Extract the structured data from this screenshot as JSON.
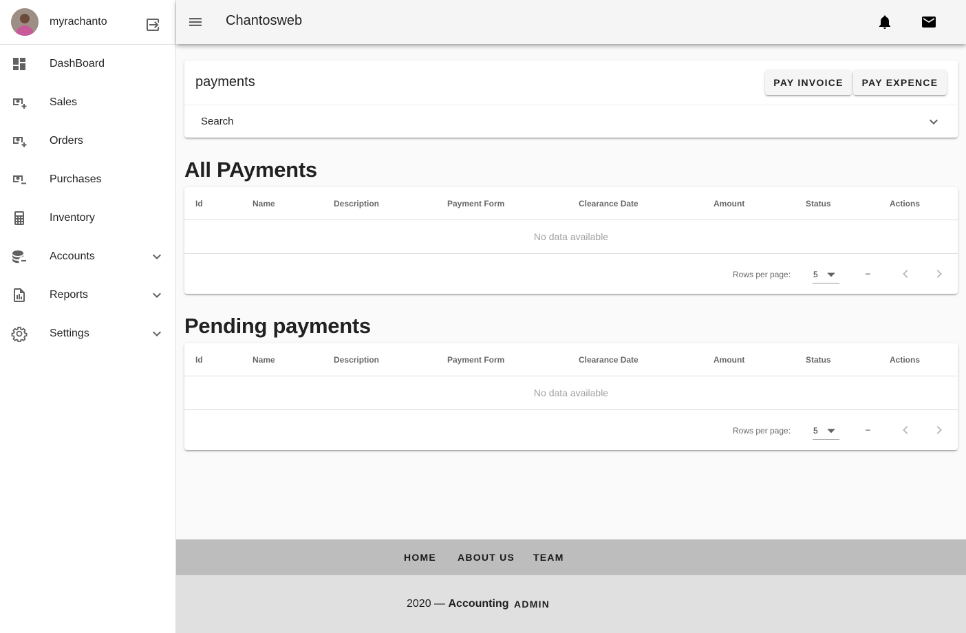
{
  "user": {
    "name": "myrachanto"
  },
  "sidebar": {
    "items": [
      {
        "label": "DashBoard",
        "icon": "dashboard-icon"
      },
      {
        "label": "Sales",
        "icon": "cash-plus-icon"
      },
      {
        "label": "Orders",
        "icon": "cash-plus-icon"
      },
      {
        "label": "Purchases",
        "icon": "cash-minus-icon"
      },
      {
        "label": "Inventory",
        "icon": "calculator-icon"
      },
      {
        "label": "Accounts",
        "icon": "database-minus-icon",
        "expandable": true
      },
      {
        "label": "Reports",
        "icon": "file-chart-icon",
        "expandable": true
      },
      {
        "label": "Settings",
        "icon": "gear-icon",
        "expandable": true
      }
    ]
  },
  "header": {
    "title": "Chantosweb"
  },
  "page": {
    "title": "payments",
    "buttons": {
      "pay_invoice": "PAY INVOICE",
      "pay_expence": "PAY EXPENCE"
    },
    "search_label": "Search"
  },
  "tables": [
    {
      "title": "All PAyments",
      "columns": [
        "Id",
        "Name",
        "Description",
        "Payment Form",
        "Clearance Date",
        "Amount",
        "Status",
        "Actions"
      ],
      "empty_text": "No data available",
      "rows_per_page_label": "Rows per page:",
      "rows_per_page_value": "5",
      "range_text": "–"
    },
    {
      "title": "Pending payments",
      "columns": [
        "Id",
        "Name",
        "Description",
        "Payment Form",
        "Clearance Date",
        "Amount",
        "Status",
        "Actions"
      ],
      "empty_text": "No data available",
      "rows_per_page_label": "Rows per page:",
      "rows_per_page_value": "5",
      "range_text": "–"
    }
  ],
  "footer": {
    "links": [
      "HOME",
      "ABOUT US",
      "TEAM"
    ],
    "year": "2020",
    "separator": "—",
    "brand": "Accounting",
    "admin": "ADMIN"
  },
  "colors": {
    "topbar": "#f5f5f5",
    "footer_links_bg": "#bdbdbd",
    "footer_bottom_bg": "#e0e0e0"
  }
}
